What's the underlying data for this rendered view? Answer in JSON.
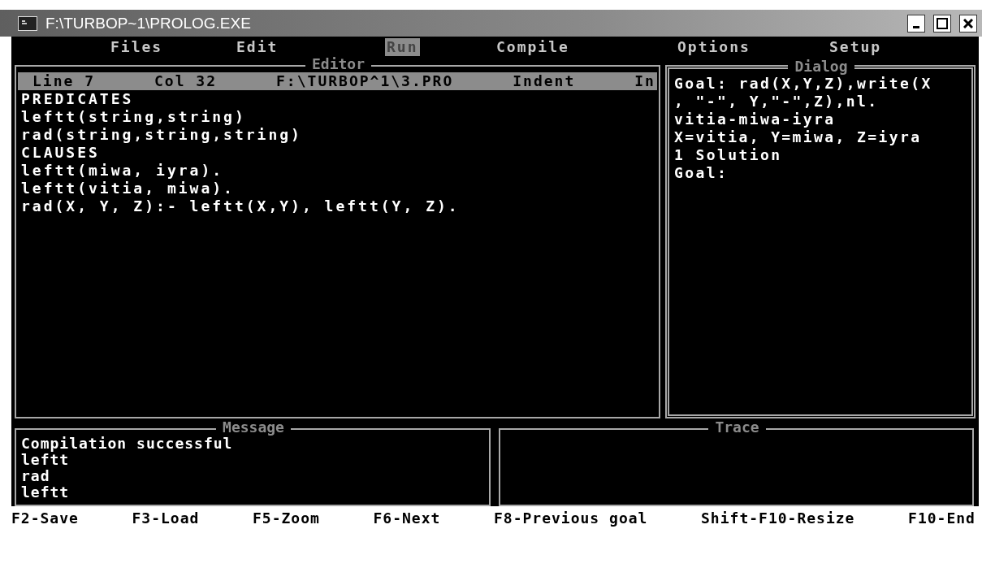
{
  "window": {
    "title": "F:\\TURBOP~1\\PROLOG.EXE"
  },
  "menu": [
    {
      "label": "Files",
      "selected": false
    },
    {
      "label": "Edit",
      "selected": false
    },
    {
      "label": "Run",
      "selected": true
    },
    {
      "label": "Compile",
      "selected": false
    },
    {
      "label": "Options",
      "selected": false
    },
    {
      "label": "Setup",
      "selected": false
    }
  ],
  "editor": {
    "title": "Editor",
    "active": false,
    "status": [
      "Line 7",
      "Col 32",
      "F:\\TURBOP^1\\3.PRO",
      "Indent",
      "In"
    ],
    "lines": [
      "PREDICATES",
      "leftt(string,string)",
      "rad(string,string,string)",
      "CLAUSES",
      "leftt(miwa, iyra).",
      "leftt(vitia, miwa).",
      "rad(X, Y, Z):- leftt(X,Y), leftt(Y, Z)."
    ]
  },
  "dialog": {
    "title": "Dialog",
    "active": true,
    "lines": [
      "Goal: rad(X,Y,Z),write(X",
      ", \"-\", Y,\"-\",Z),nl.",
      "vitia-miwa-iyra",
      "X=vitia, Y=miwa, Z=iyra",
      "1 Solution",
      "Goal:"
    ]
  },
  "message": {
    "title": "Message",
    "active": false,
    "lines": [
      "Compilation successful",
      "leftt",
      "rad",
      "leftt"
    ]
  },
  "trace": {
    "title": "Trace",
    "active": false
  },
  "status_bar": [
    "F2-Save",
    "F3-Load",
    "F5-Zoom",
    "F6-Next",
    "F8-Previous goal",
    "Shift-F10-Resize",
    "F10-End"
  ]
}
